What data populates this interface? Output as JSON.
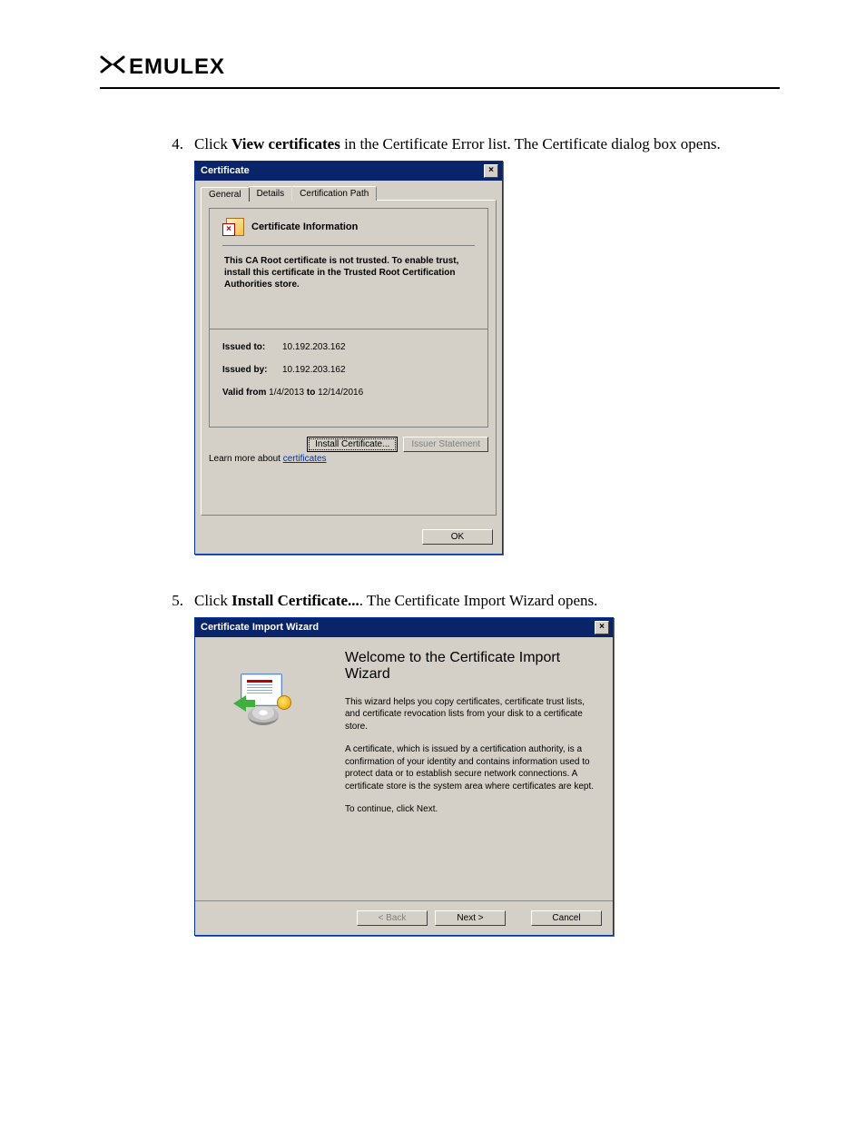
{
  "header": {
    "brand": "EMULEX"
  },
  "step4": {
    "num": "4.",
    "pre": "Click ",
    "bold": "View certificates",
    "post": " in the Certificate Error list. The Certificate dialog box opens."
  },
  "step5": {
    "num": "5.",
    "pre": "Click ",
    "bold": "Install Certificate...",
    "post": ". The Certificate Import Wizard opens."
  },
  "certDialog": {
    "title": "Certificate",
    "tabs": {
      "general": "General",
      "details": "Details",
      "path": "Certification Path"
    },
    "infoTitle": "Certificate Information",
    "untrusted": "This CA Root certificate is not trusted. To enable trust, install this certificate in the Trusted Root Certification Authorities store.",
    "issuedToLabel": "Issued to:",
    "issuedToVal": "10.192.203.162",
    "issuedByLabel": "Issued by:",
    "issuedByVal": "10.192.203.162",
    "validFromLabel": "Valid from",
    "validFromVal": "1/4/2013",
    "validToLabel": "to",
    "validToVal": "12/14/2016",
    "installBtn": "Install Certificate...",
    "issuerBtn": "Issuer Statement",
    "learnPre": "Learn more about ",
    "learnLink": "certificates",
    "okBtn": "OK"
  },
  "wizard": {
    "title": "Certificate Import Wizard",
    "heading": "Welcome to the Certificate Import Wizard",
    "p1": "This wizard helps you copy certificates, certificate trust lists, and certificate revocation lists from your disk to a certificate store.",
    "p2": "A certificate, which is issued by a certification authority, is a confirmation of your identity and contains information used to protect data or to establish secure network connections. A certificate store is the system area where certificates are kept.",
    "p3": "To continue, click Next.",
    "back": "< Back",
    "next": "Next >",
    "cancel": "Cancel"
  }
}
